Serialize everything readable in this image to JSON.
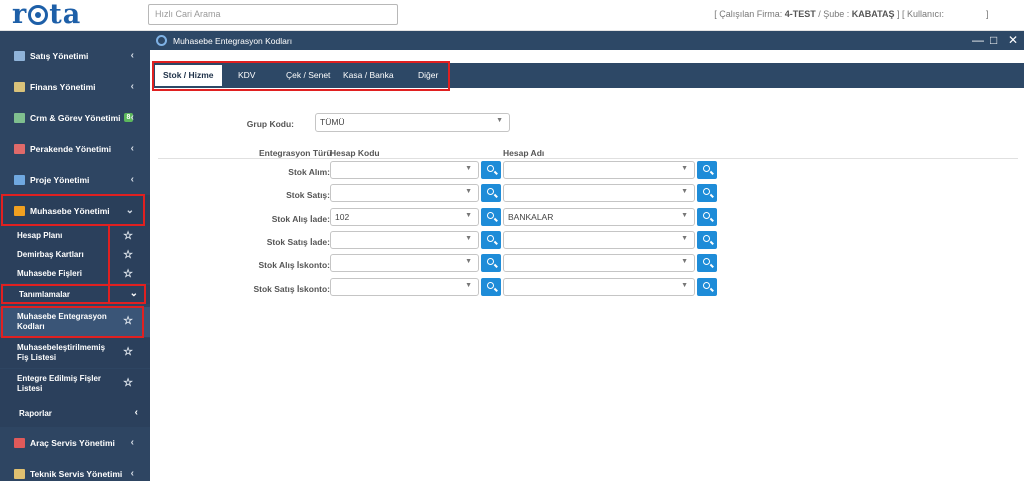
{
  "header": {
    "logo": "rota",
    "search_placeholder": "Hızlı Cari Arama",
    "user_info_prefix": "[ Çalışılan Firma: ",
    "firm": "4-TEST",
    "branch_label": " / Şube : ",
    "branch": "KABATAŞ",
    "user_label": "] [ Kullanıcı:",
    "user_close": "]"
  },
  "sidebar": {
    "items": [
      {
        "label": "Satış Yönetimi",
        "icon": "cart-icon",
        "color": "#8fb3d9"
      },
      {
        "label": "Finans Yönetimi",
        "icon": "bank-icon",
        "color": "#d9c27a"
      },
      {
        "label": "Crm & Görev Yönetimi",
        "icon": "list-icon",
        "color": "#7fbf8f",
        "badge": "8"
      },
      {
        "label": "Perakende Yönetimi",
        "icon": "basket-icon",
        "color": "#e06a6a"
      },
      {
        "label": "Proje Yönetimi",
        "icon": "folder-icon",
        "color": "#6fa8e0"
      },
      {
        "label": "Muhasebe Yönetimi",
        "icon": "accounting-icon",
        "color": "#f0a020"
      }
    ],
    "sub_items": [
      {
        "label": "Hesap Planı"
      },
      {
        "label": "Demirbaş Kartları"
      },
      {
        "label": "Muhasebe Fişleri"
      }
    ],
    "group": "Tanımlamalar",
    "group_items": [
      {
        "label": "Muhasebe Entegrasyon Kodları"
      },
      {
        "label": "Muhasebeleştirilmemiş Fiş Listesi"
      },
      {
        "label": "Entegre Edilmiş Fişler Listesi"
      }
    ],
    "reports": "Raporlar",
    "bottom_items": [
      {
        "label": "Araç Servis Yönetimi",
        "icon": "car-icon",
        "color": "#e05a5a"
      },
      {
        "label": "Teknik Servis Yönetimi",
        "icon": "tools-icon",
        "color": "#e0c070"
      }
    ]
  },
  "window": {
    "title": "Muhasebe Entegrasyon Kodları",
    "controls": [
      "—",
      "□",
      "✕"
    ]
  },
  "tabs": [
    {
      "label": "Stok / Hizme",
      "active": true
    },
    {
      "label": "KDV",
      "active": false
    },
    {
      "label": "Çek / Senet",
      "active": false
    },
    {
      "label": "Kasa / Banka",
      "active": false
    },
    {
      "label": "Diğer",
      "active": false
    }
  ],
  "form": {
    "group_code_label": "Grup Kodu:",
    "group_code_value": "TÜMÜ",
    "col_type": "Entegrasyon Türü",
    "col_code": "Hesap Kodu",
    "col_name": "Hesap Adı",
    "rows": [
      {
        "label": "Stok Alım:",
        "code": "",
        "name": ""
      },
      {
        "label": "Stok Satış:",
        "code": "",
        "name": ""
      },
      {
        "label": "Stok Alış İade:",
        "code": "102",
        "name": "BANKALAR"
      },
      {
        "label": "Stok Satış İade:",
        "code": "",
        "name": ""
      },
      {
        "label": "Stok Alış İskonto:",
        "code": "",
        "name": ""
      },
      {
        "label": "Stok Satış İskonto:",
        "code": "",
        "name": ""
      }
    ]
  },
  "colors": {
    "sidebar_bg": "#2e4562",
    "titlebar_bg": "#2d4866",
    "button_blue": "#1e8cd8",
    "highlight_red": "#e02020"
  }
}
